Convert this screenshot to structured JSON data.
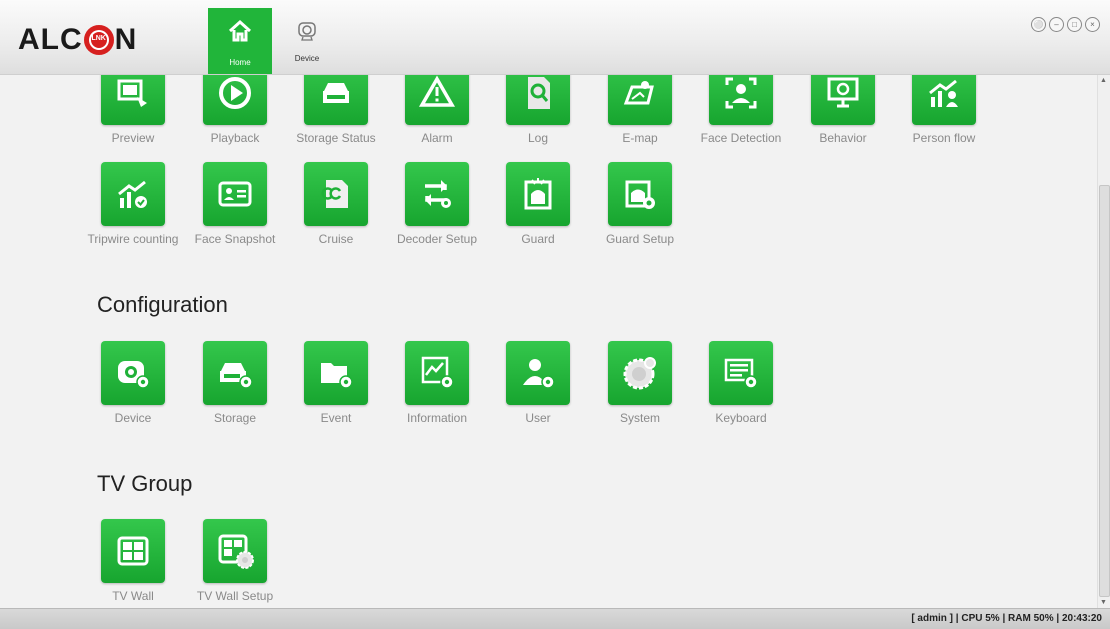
{
  "brand": {
    "logo_left": "ALC",
    "logo_ring": "LNK",
    "logo_right": "N"
  },
  "nav": [
    {
      "label": "Home",
      "icon": "home-icon",
      "active": true
    },
    {
      "label": "Device",
      "icon": "device-icon",
      "active": false
    }
  ],
  "colors": {
    "accent": "#21b53a",
    "tile": "#1fb138",
    "status_bar": "#cfcfcf"
  },
  "operation": {
    "items": [
      {
        "label": "Preview",
        "icon": "preview-icon"
      },
      {
        "label": "Playback",
        "icon": "playback-icon"
      },
      {
        "label": "Storage Status",
        "icon": "storage-status-icon"
      },
      {
        "label": "Alarm",
        "icon": "alarm-icon"
      },
      {
        "label": "Log",
        "icon": "log-icon"
      },
      {
        "label": "E-map",
        "icon": "emap-icon"
      },
      {
        "label": "Face Detection",
        "icon": "face-detection-icon"
      },
      {
        "label": "Behavior",
        "icon": "behavior-icon"
      },
      {
        "label": "Person flow",
        "icon": "person-flow-icon"
      },
      {
        "label": "Tripwire counting",
        "icon": "tripwire-counting-icon"
      },
      {
        "label": "Face Snapshot",
        "icon": "face-snapshot-icon"
      },
      {
        "label": "Cruise",
        "icon": "cruise-icon"
      },
      {
        "label": "Decoder Setup",
        "icon": "decoder-setup-icon"
      },
      {
        "label": "Guard",
        "icon": "guard-icon"
      },
      {
        "label": "Guard Setup",
        "icon": "guard-setup-icon"
      }
    ]
  },
  "configuration": {
    "title": "Configuration",
    "items": [
      {
        "label": "Device",
        "icon": "device-config-icon"
      },
      {
        "label": "Storage",
        "icon": "storage-config-icon"
      },
      {
        "label": "Event",
        "icon": "event-config-icon"
      },
      {
        "label": "Information",
        "icon": "information-icon"
      },
      {
        "label": "User",
        "icon": "user-config-icon"
      },
      {
        "label": "System",
        "icon": "system-gear-icon"
      },
      {
        "label": "Keyboard",
        "icon": "keyboard-config-icon"
      }
    ]
  },
  "tv_group": {
    "title": "TV Group",
    "items": [
      {
        "label": "TV Wall",
        "icon": "tv-wall-icon"
      },
      {
        "label": "TV Wall Setup",
        "icon": "tv-wall-setup-icon"
      }
    ]
  },
  "status": {
    "text": "[ admin ] | CPU  5% | RAM  50% | 20:43:20"
  }
}
